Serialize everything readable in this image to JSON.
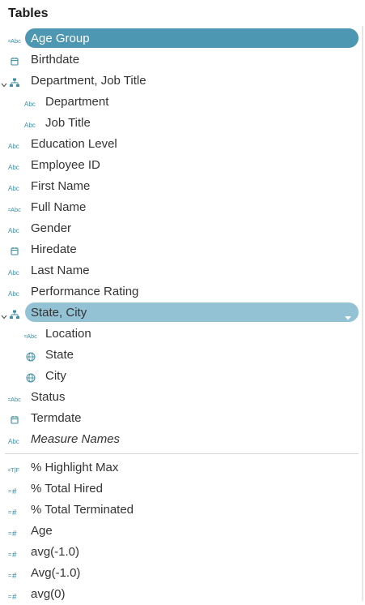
{
  "header": {
    "title": "Tables"
  },
  "dimensions": [
    {
      "label": "Age Group",
      "icon": "abc-group-icon",
      "level": 0,
      "state": "selected"
    },
    {
      "label": "Birthdate",
      "icon": "calendar-icon",
      "level": 0
    },
    {
      "label": "Department, Job Title",
      "icon": "hierarchy-icon",
      "level": 0,
      "expanded": true
    },
    {
      "label": "Department",
      "icon": "abc-icon",
      "level": 1
    },
    {
      "label": "Job Title",
      "icon": "abc-icon",
      "level": 1
    },
    {
      "label": "Education Level",
      "icon": "abc-icon",
      "level": 0
    },
    {
      "label": "Employee ID",
      "icon": "abc-icon",
      "level": 0
    },
    {
      "label": "First Name",
      "icon": "abc-icon",
      "level": 0
    },
    {
      "label": "Full Name",
      "icon": "abc-calc-icon",
      "level": 0
    },
    {
      "label": "Gender",
      "icon": "abc-icon",
      "level": 0
    },
    {
      "label": "Hiredate",
      "icon": "calendar-icon",
      "level": 0
    },
    {
      "label": "Last Name",
      "icon": "abc-icon",
      "level": 0
    },
    {
      "label": "Performance Rating",
      "icon": "abc-icon",
      "level": 0
    },
    {
      "label": "State, City",
      "icon": "hierarchy-icon",
      "level": 0,
      "expanded": true,
      "state": "hover"
    },
    {
      "label": "Location",
      "icon": "abc-calc-icon",
      "level": 1
    },
    {
      "label": "State",
      "icon": "globe-icon",
      "level": 1
    },
    {
      "label": "City",
      "icon": "globe-icon",
      "level": 1
    },
    {
      "label": "Status",
      "icon": "abc-calc-icon",
      "level": 0
    },
    {
      "label": "Termdate",
      "icon": "calendar-icon",
      "level": 0
    },
    {
      "label": "Measure Names",
      "icon": "abc-icon",
      "level": 0,
      "italic": true
    }
  ],
  "measures": [
    {
      "label": "% Highlight Max",
      "icon": "tf-calc-icon"
    },
    {
      "label": "% Total Hired",
      "icon": "number-calc-icon"
    },
    {
      "label": "% Total Terminated",
      "icon": "number-calc-icon"
    },
    {
      "label": "Age",
      "icon": "number-calc-icon"
    },
    {
      "label": "avg(-1.0)",
      "icon": "number-calc-icon"
    },
    {
      "label": "Avg(-1.0)",
      "icon": "number-calc-icon"
    },
    {
      "label": "avg(0)",
      "icon": "number-calc-icon"
    }
  ],
  "icon_text": {
    "abc": "Abc",
    "tf": "T|F",
    "hash": "#",
    "calc": "="
  },
  "colors": {
    "icon_teal": "#3f8ea3",
    "selected_pill": "#4e97b2",
    "hover_pill": "#93c2d4",
    "label_text": "#333333"
  }
}
